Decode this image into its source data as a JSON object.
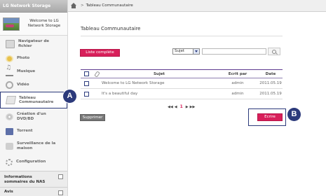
{
  "sidebar": {
    "brand": "LG Network Storage",
    "device_line1": "Welcome to LG",
    "device_line2": "Network Storage",
    "items": [
      {
        "line1": "Navigateur de",
        "line2": "fichier",
        "icon": "folder-icon"
      },
      {
        "line1": "Photo",
        "line2": "",
        "icon": "photo-icon"
      },
      {
        "line1": "Musique",
        "line2": "",
        "icon": "music-icon"
      },
      {
        "line1": "Vidéo",
        "line2": "",
        "icon": "video-icon"
      },
      {
        "line1": "Tableau",
        "line2": "Communautaire",
        "icon": "board-icon"
      },
      {
        "line1": "Création d'un",
        "line2": "DVD/BD",
        "icon": "disc-icon"
      },
      {
        "line1": "Torrent",
        "line2": "",
        "icon": "torrent-icon"
      },
      {
        "line1": "Surveillance de la",
        "line2": "maison",
        "icon": "camera-icon"
      },
      {
        "line1": "Configuration",
        "line2": "",
        "icon": "gear-icon"
      }
    ],
    "footer": {
      "info_line1": "Informations",
      "info_line2": "sommaires du NAS",
      "avis": "Avis"
    }
  },
  "topbar": {
    "breadcrumb_sep": ">",
    "breadcrumb": "Tableau Communautaire"
  },
  "main": {
    "title": "Tableau Communautaire",
    "list_button": "Liste complète",
    "search_select": "Sujet",
    "search_value": "",
    "table": {
      "headers": {
        "subject": "Sujet",
        "author": "Ecrit par",
        "date": "Date"
      },
      "rows": [
        {
          "subject": "Welcome to LG Network Storage",
          "author": "admin",
          "date": "2011.05.19"
        },
        {
          "subject": "It's a beautiful day",
          "author": "admin",
          "date": "2011.05.19"
        }
      ]
    },
    "pager": {
      "first": "◀◀",
      "prev": "◀",
      "current": "1",
      "next": "▶",
      "last": "▶▶"
    },
    "delete_button": "Supprimer",
    "write_button": "Ecrire"
  },
  "callouts": {
    "a": "A",
    "b": "B"
  },
  "colors": {
    "accent": "#d81f5a",
    "callout": "#2c3a7b"
  }
}
